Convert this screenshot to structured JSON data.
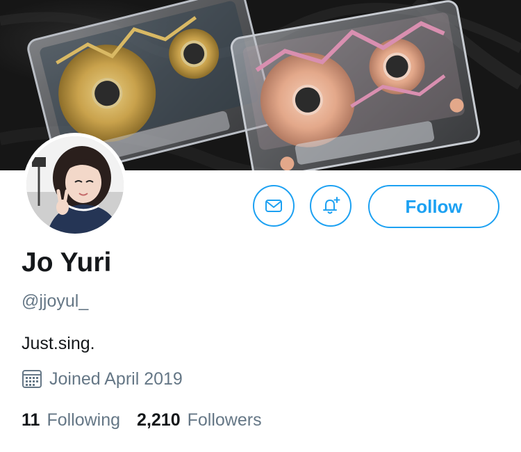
{
  "colors": {
    "accent": "#1da1f2",
    "primary_text": "#14171a",
    "secondary_text": "#657786",
    "background": "#ffffff"
  },
  "profile": {
    "name": "Jo Yuri",
    "handle": "@jjoyul_",
    "bio": "Just.sing.",
    "joined": "Joined April 2019",
    "banner_image": "banner-photo-cassette-tapes",
    "avatar_image": "profile-photo"
  },
  "actions": {
    "message_icon": "envelope-icon",
    "notify_icon": "bell-plus-icon",
    "follow_label": "Follow"
  },
  "stats": {
    "following_count": "11",
    "following_label": "Following",
    "followers_count": "2,210",
    "followers_label": "Followers"
  }
}
